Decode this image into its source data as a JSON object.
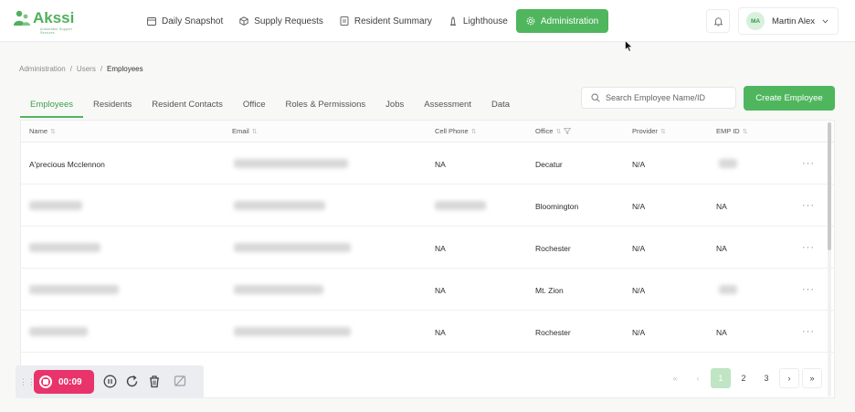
{
  "brand": {
    "name": "Akssi",
    "tagline": "Automated Support Services",
    "color": "#4fb05b"
  },
  "nav": {
    "items": [
      {
        "label": "Daily Snapshot",
        "icon": "calendar-icon"
      },
      {
        "label": "Supply Requests",
        "icon": "box-icon"
      },
      {
        "label": "Resident Summary",
        "icon": "document-icon"
      },
      {
        "label": "Lighthouse",
        "icon": "lighthouse-icon"
      },
      {
        "label": "Administration",
        "icon": "gear-icon",
        "active": true
      }
    ]
  },
  "user": {
    "initials": "MA",
    "name": "Martin Alex"
  },
  "breadcrumb": [
    "Administration",
    "Users",
    "Employees"
  ],
  "tabs": [
    "Employees",
    "Residents",
    "Resident Contacts",
    "Office",
    "Roles & Permissions",
    "Jobs",
    "Assessment",
    "Data"
  ],
  "search": {
    "placeholder": "Search Employee Name/ID"
  },
  "create_button": "Create Employee",
  "table": {
    "columns": [
      "Name",
      "Email",
      "Cell Phone",
      "Office",
      "Provider",
      "EMP ID"
    ],
    "rows": [
      {
        "name": "A'precious Mcclennon",
        "cell": "NA",
        "office": "Decatur",
        "provider": "N/A",
        "emp": ""
      },
      {
        "name": "",
        "cell": "",
        "office": "Bloomington",
        "provider": "N/A",
        "emp": "NA"
      },
      {
        "name": "",
        "cell": "NA",
        "office": "Rochester",
        "provider": "N/A",
        "emp": "NA"
      },
      {
        "name": "",
        "cell": "NA",
        "office": "Mt. Zion",
        "provider": "N/A",
        "emp": ""
      },
      {
        "name": "",
        "cell": "NA",
        "office": "Rochester",
        "provider": "N/A",
        "emp": "NA"
      }
    ]
  },
  "recorder": {
    "time": "00:09"
  },
  "pagination": {
    "pages": [
      "1",
      "2",
      "3"
    ],
    "first": "«",
    "prev": "‹",
    "next": "›",
    "last": "»",
    "current": "1"
  }
}
